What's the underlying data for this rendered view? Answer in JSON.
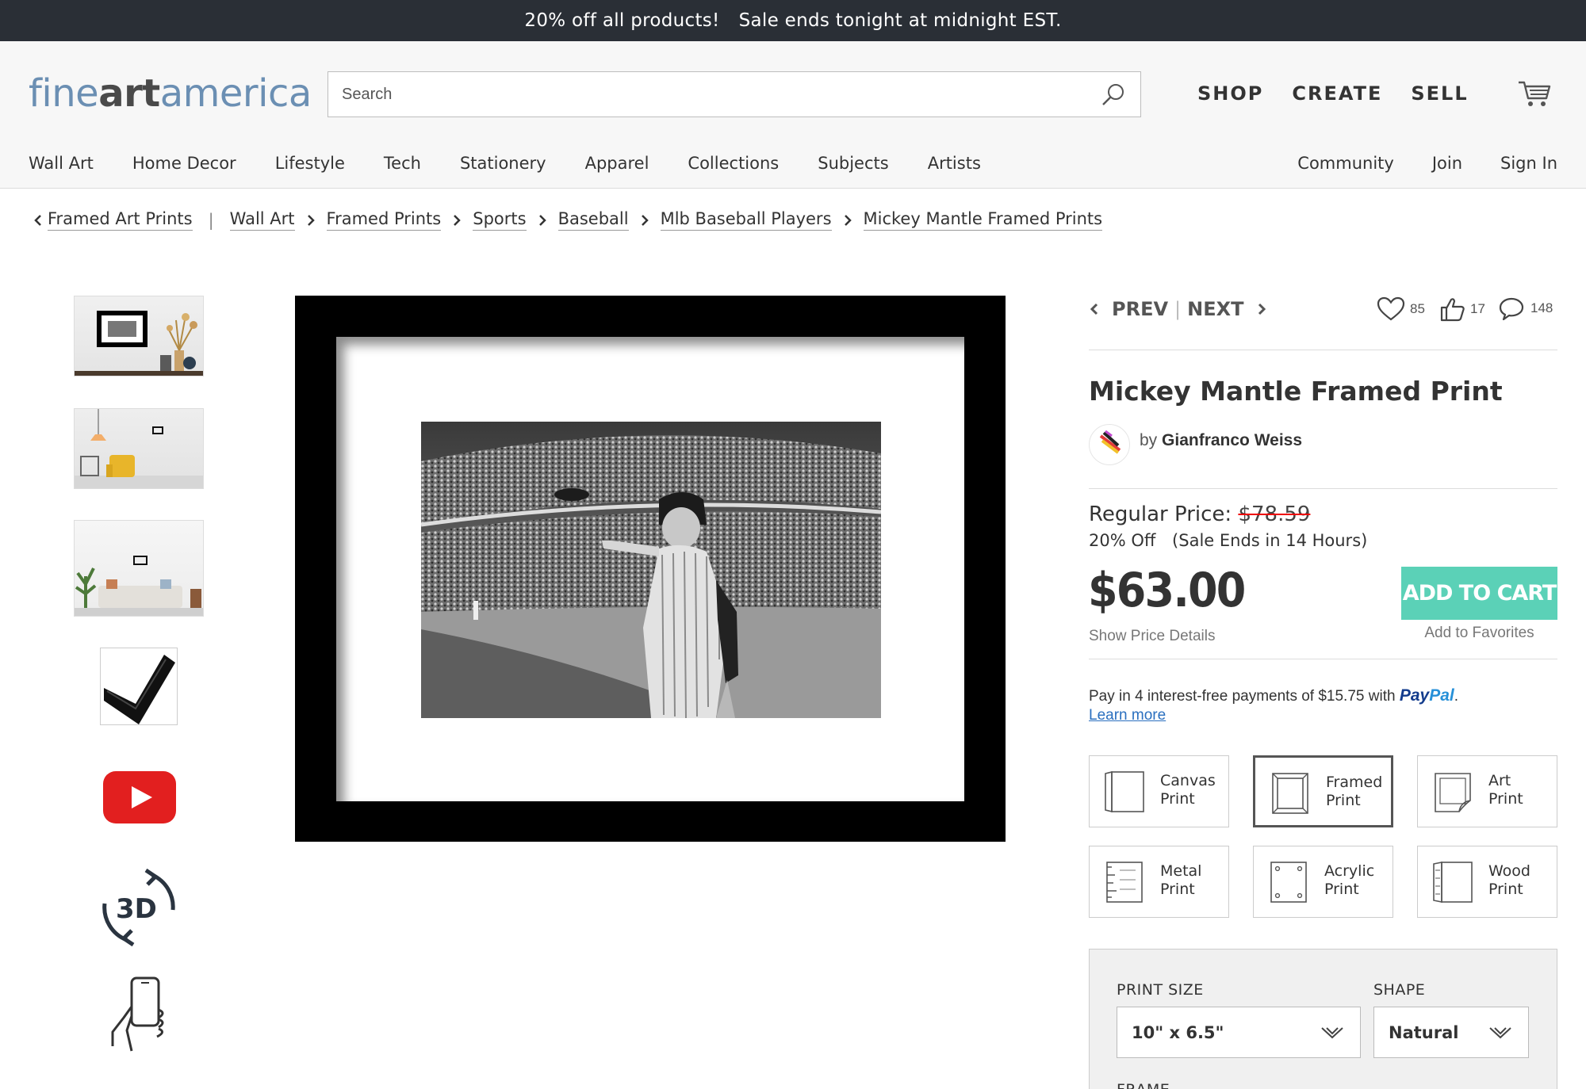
{
  "promo": {
    "offer": "20% off all products!",
    "deadline": "Sale ends tonight at midnight EST."
  },
  "header": {
    "logo_light_1": "fine",
    "logo_bold": "art",
    "logo_light_2": "america",
    "search_placeholder": "Search",
    "top_links": [
      "SHOP",
      "CREATE",
      "SELL"
    ]
  },
  "nav": {
    "items": [
      "Wall Art",
      "Home Decor",
      "Lifestyle",
      "Tech",
      "Stationery",
      "Apparel",
      "Collections",
      "Subjects",
      "Artists"
    ],
    "right": [
      "Community",
      "Join",
      "Sign In"
    ]
  },
  "breadcrumb": {
    "back": "Framed Art Prints",
    "items": [
      "Wall Art",
      "Framed Prints",
      "Sports",
      "Baseball",
      "Mlb Baseball Players",
      "Mickey Mantle Framed Prints"
    ]
  },
  "product": {
    "prev": "PREV",
    "next": "NEXT",
    "favorites_count": "85",
    "likes_count": "17",
    "comments_count": "148",
    "title": "Mickey Mantle Framed Print",
    "by": "by",
    "artist": "Gianfranco Weiss",
    "regular_price_label": "Regular Price:",
    "regular_price": "$78.59",
    "discount": "20% Off",
    "sale_ends": "(Sale Ends in 14 Hours)",
    "price": "$63.00",
    "show_price_details": "Show Price Details",
    "add_to_cart": "ADD TO CART",
    "add_to_favorites": "Add to Favorites",
    "paypal_text": "Pay in 4 interest-free payments of $15.75 with",
    "paypal_brand_1": "Pay",
    "paypal_brand_2": "Pal",
    "paypal_period": ".",
    "learn_more": "Learn more"
  },
  "product_types": [
    {
      "line1": "Canvas",
      "line2": "Print"
    },
    {
      "line1": "Framed",
      "line2": "Print"
    },
    {
      "line1": "Art",
      "line2": "Print"
    },
    {
      "line1": "Metal",
      "line2": "Print"
    },
    {
      "line1": "Acrylic",
      "line2": "Print"
    },
    {
      "line1": "Wood",
      "line2": "Print"
    }
  ],
  "options": {
    "print_size_label": "PRINT SIZE",
    "print_size_value": "10\" x 6.5\"",
    "shape_label": "SHAPE",
    "shape_value": "Natural",
    "frame_label": "FRAME"
  },
  "colors": {
    "promo_bg": "#2a2f36",
    "add_to_cart_bg": "#5bd1b7",
    "link": "#2a6fbf",
    "strike": "#e00000"
  }
}
